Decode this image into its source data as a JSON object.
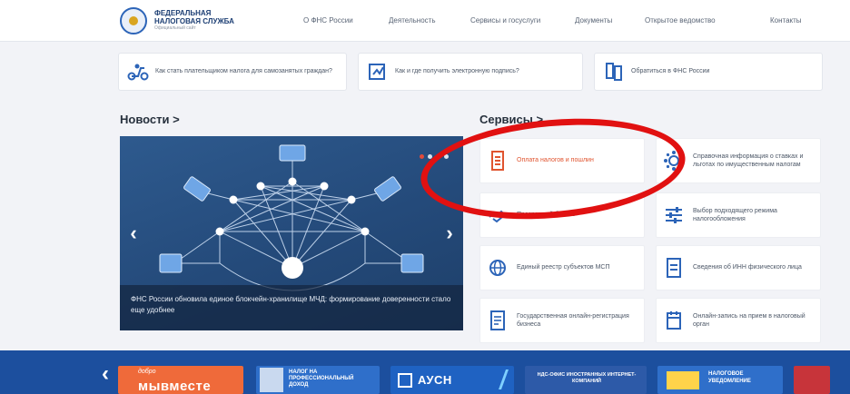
{
  "header": {
    "logo_line1": "ФЕДЕРАЛЬНАЯ",
    "logo_line2": "НАЛОГОВАЯ СЛУЖБА",
    "logo_sub": "Официальный сайт",
    "nav": [
      "О ФНС России",
      "Деятельность",
      "Сервисы и госуслуги",
      "Документы",
      "Открытое ведомство",
      "Контакты"
    ]
  },
  "quick_links": [
    {
      "label": "Как стать плательщиком налога для самозанятых граждан?",
      "icon": "scooter-icon"
    },
    {
      "label": "Как и где получить электронную подпись?",
      "icon": "signature-icon"
    },
    {
      "label": "Обратиться в ФНС России",
      "icon": "documents-icon"
    }
  ],
  "news": {
    "title": "Новости >",
    "caption": "ФНС России обновила единое блокчейн-хранилище МЧД: формирование доверенности стало еще удобнее"
  },
  "services": {
    "title": "Сервисы >",
    "items": [
      {
        "label": "Оплата налогов и пошлин",
        "icon": "receipt-icon",
        "highlight": true
      },
      {
        "label": "Справочная информация о ставках и льготах по имущественным налогам",
        "icon": "gear-network-icon"
      },
      {
        "label": "Прозрачный бизнес",
        "icon": "handshake-icon"
      },
      {
        "label": "Выбор подходящего режима налогообложения",
        "icon": "sliders-icon"
      },
      {
        "label": "Единый реестр субъектов МСП",
        "icon": "globe-icon"
      },
      {
        "label": "Сведения об ИНН физического лица",
        "icon": "id-card-icon"
      },
      {
        "label": "Государственная онлайн-регистрация бизнеса",
        "icon": "document-icon"
      },
      {
        "label": "Онлайн-запись на прием в налоговый орган",
        "icon": "calendar-icon"
      }
    ]
  },
  "banners": [
    {
      "text": "мывместе",
      "small": "добро"
    },
    {
      "text": "НАЛОГ НА ПРОФЕССИОНАЛЬНЫЙ ДОХОД"
    },
    {
      "text": "АУСН"
    },
    {
      "text": "НДС-ОФИС ИНОСТРАННЫХ ИНТЕРНЕТ-КОМПАНИЙ"
    },
    {
      "text": "НАЛОГОВОЕ УВЕДОМЛЕНИЕ"
    }
  ],
  "colors": {
    "brand_blue": "#1c4f9e",
    "accent_orange": "#e0542f",
    "annotation_red": "#e11111"
  }
}
